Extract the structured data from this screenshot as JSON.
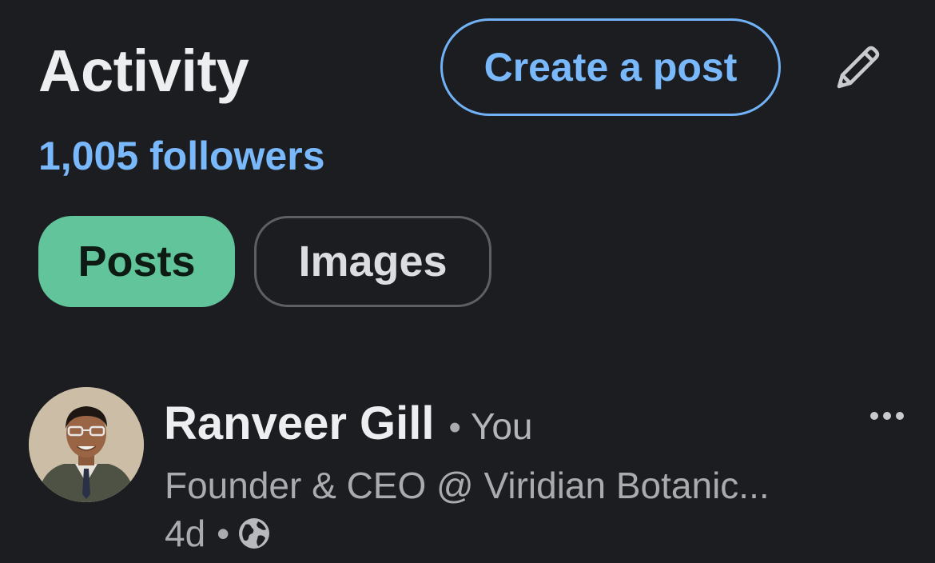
{
  "activity": {
    "title": "Activity",
    "create_post_label": "Create a post",
    "edit_icon": "pencil-icon",
    "followers_text": "1,005 followers"
  },
  "filters": {
    "selected": "Posts",
    "items": [
      {
        "label": "Posts"
      },
      {
        "label": "Images"
      }
    ]
  },
  "post": {
    "author_name": "Ranveer Gill",
    "separator": "•",
    "relation": "You",
    "headline": "Founder & CEO @ Viridian Botanic...",
    "age": "4d",
    "visibility_icon": "globe-icon",
    "more_icon": "ellipsis-icon",
    "avatar_icon": "avatar"
  },
  "colors": {
    "background": "#1c1d21",
    "accent_blue": "#78b8fb",
    "chip_selected": "#61c49a",
    "text_primary": "#eceef0",
    "text_secondary": "#a9abaf"
  }
}
